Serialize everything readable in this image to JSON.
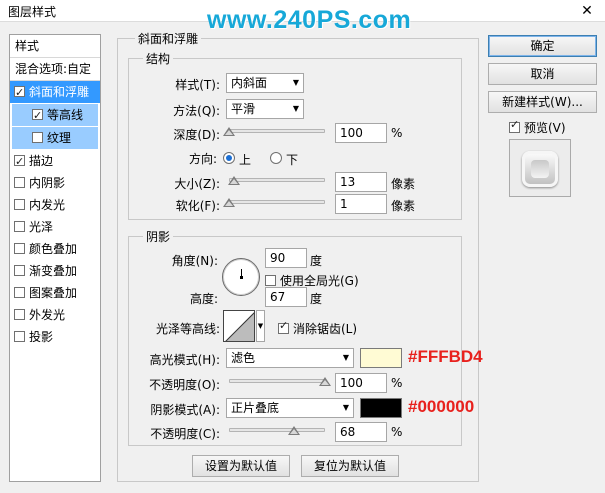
{
  "window": {
    "title": "图层样式",
    "watermark": "www.240PS.com",
    "close_glyph": "✕"
  },
  "left_panel": {
    "header": "样式",
    "blend": "混合选项:自定",
    "items": [
      {
        "label": "斜面和浮雕",
        "checked": true
      },
      {
        "label": "等高线",
        "checked": true
      },
      {
        "label": "纹理",
        "checked": false
      },
      {
        "label": "描边",
        "checked": true
      },
      {
        "label": "内阴影",
        "checked": false
      },
      {
        "label": "内发光",
        "checked": false
      },
      {
        "label": "光泽",
        "checked": false
      },
      {
        "label": "颜色叠加",
        "checked": false
      },
      {
        "label": "渐变叠加",
        "checked": false
      },
      {
        "label": "图案叠加",
        "checked": false
      },
      {
        "label": "外发光",
        "checked": false
      },
      {
        "label": "投影",
        "checked": false
      }
    ]
  },
  "main": {
    "group_title": "斜面和浮雕",
    "structure": {
      "title": "结构",
      "style_label": "样式(T):",
      "style_value": "内斜面",
      "technique_label": "方法(Q):",
      "technique_value": "平滑",
      "depth_label": "深度(D):",
      "depth_value": "100",
      "depth_unit": "%",
      "depth_fraction": 0.0,
      "direction_label": "方向:",
      "dir_up": "上",
      "dir_down": "下",
      "size_label": "大小(Z):",
      "size_value": "13",
      "size_unit": "像素",
      "size_fraction": 0.05,
      "soften_label": "软化(F):",
      "soften_value": "1",
      "soften_unit": "像素",
      "soften_fraction": 0.0
    },
    "shading": {
      "title": "阴影",
      "angle_label": "角度(N):",
      "angle_value": "90",
      "angle_unit": "度",
      "global_light_label": "使用全局光(G)",
      "global_light_checked": false,
      "altitude_label": "高度:",
      "altitude_value": "67",
      "altitude_unit": "度",
      "gloss_label": "光泽等高线:",
      "antialias_label": "消除锯齿(L)",
      "antialias_checked": true,
      "highlight_label": "高光模式(H):",
      "highlight_value": "滤色",
      "highlight_color": "#FFFBD4",
      "highlight_hex": "#FFFBD4",
      "hl_opacity_label": "不透明度(O):",
      "hl_opacity_value": "100",
      "hl_opacity_unit": "%",
      "hl_opacity_fraction": 1.0,
      "shadow_label": "阴影模式(A):",
      "shadow_value": "正片叠底",
      "shadow_color": "#000000",
      "shadow_hex": "#000000",
      "sh_opacity_label": "不透明度(C):",
      "sh_opacity_value": "68",
      "sh_opacity_unit": "%",
      "sh_opacity_fraction": 0.68
    },
    "make_default": "设置为默认值",
    "reset_default": "复位为默认值"
  },
  "right": {
    "ok": "确定",
    "cancel": "取消",
    "new_style": "新建样式(W)...",
    "preview_label": "预览(V)",
    "preview_checked": true
  }
}
